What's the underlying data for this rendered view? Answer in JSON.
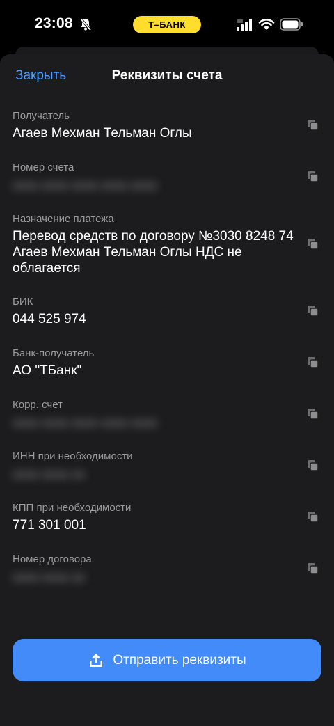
{
  "status_bar": {
    "time": "23:08",
    "bank_badge": "Т–БАНК"
  },
  "colors": {
    "accent_blue": "#4a9eff",
    "button_blue": "#428bf9",
    "badge_yellow": "#ffdd2d",
    "sheet_background": "#1c1c1e",
    "label_gray": "#9a9a9e"
  },
  "header": {
    "close_label": "Закрыть",
    "title": "Реквизиты счета"
  },
  "fields": [
    {
      "label": "Получатель",
      "value": "Агаев Мехман Тельман Оглы",
      "hidden": false
    },
    {
      "label": "Номер счета",
      "value": "0000 0000 0000 0000 0000",
      "hidden": true
    },
    {
      "label": "Назначение платежа",
      "value": "Перевод средств по договору №3030 8248 74 Агаев Мехман Тельман Оглы НДС не облагается",
      "hidden": false
    },
    {
      "label": "БИК",
      "value": "044 525 974",
      "hidden": false
    },
    {
      "label": "Банк-получатель",
      "value": "АО \"ТБанк\"",
      "hidden": false
    },
    {
      "label": "Корр. счет",
      "value": "0000 0000 0000 0000 0000",
      "hidden": true
    },
    {
      "label": "ИНН при необходимости",
      "value": "0000 0000 00",
      "hidden": true
    },
    {
      "label": "КПП при необходимости",
      "value": "771 301 001",
      "hidden": false
    },
    {
      "label": "Номер договора",
      "value": "0000 0000 00",
      "hidden": true
    }
  ],
  "icons": {
    "copy": "copy-icon",
    "share": "share-upload-icon",
    "bell": "bell-slash-icon"
  },
  "send_button": {
    "label": "Отправить реквизиты"
  }
}
